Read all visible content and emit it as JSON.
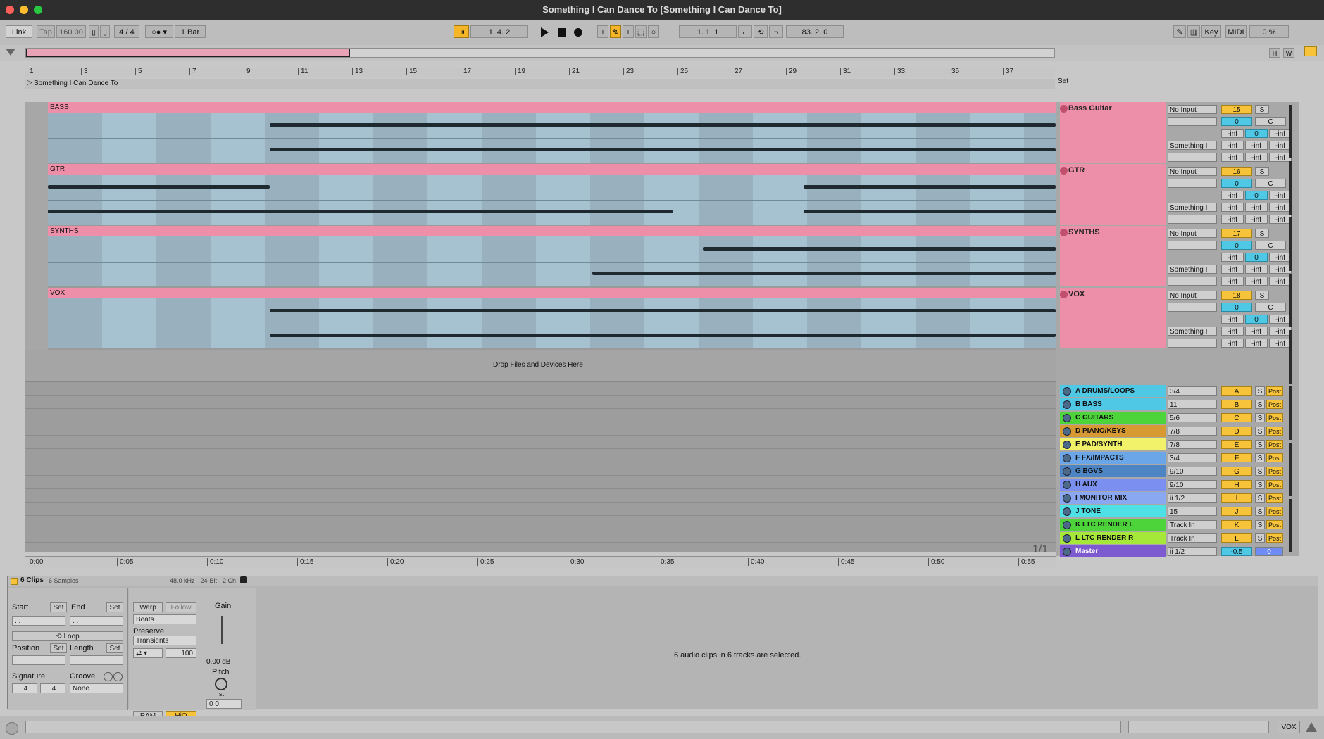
{
  "window": {
    "title": "Something I Can Dance To  [Something I Can Dance To]"
  },
  "control_bar": {
    "link": "Link",
    "tap": "Tap",
    "tempo": "160.00",
    "signature": "4 / 4",
    "quantize": "1 Bar",
    "position": "1.   4.   2",
    "loop_start": "1.   1.   1",
    "loop_length": "83.   2.   0",
    "key": "Key",
    "midi": "MIDI",
    "cpu": "0 %"
  },
  "overview": {
    "h": "H",
    "w": "W"
  },
  "ruler": {
    "bars": [
      "1",
      "3",
      "5",
      "7",
      "9",
      "11",
      "13",
      "15",
      "17",
      "19",
      "21",
      "23",
      "25",
      "27",
      "29",
      "31",
      "33",
      "35",
      "37"
    ]
  },
  "arrangement": {
    "song_name": "Something I Can Dance To",
    "drop_text": "Drop Files and Devices Here",
    "page_indicator": "1/1",
    "tracks": [
      {
        "name": "BASS"
      },
      {
        "name": "GTR"
      },
      {
        "name": "SYNTHS"
      },
      {
        "name": "VOX"
      }
    ]
  },
  "mixer": {
    "set_label": "Set",
    "tracks": [
      {
        "name": "Bass Guitar",
        "input": "No Input",
        "output": "Something I",
        "number": "15",
        "pan": "0",
        "solo": "S",
        "cue": "C",
        "inf": "-inf",
        "zero": "0"
      },
      {
        "name": "GTR",
        "input": "No Input",
        "output": "Something I",
        "number": "16",
        "pan": "0",
        "solo": "S",
        "cue": "C",
        "inf": "-inf",
        "zero": "0"
      },
      {
        "name": "SYNTHS",
        "input": "No Input",
        "output": "Something I",
        "number": "17",
        "pan": "0",
        "solo": "S",
        "cue": "C",
        "inf": "-inf",
        "zero": "0"
      },
      {
        "name": "VOX",
        "input": "No Input",
        "output": "Something I",
        "number": "18",
        "pan": "0",
        "solo": "S",
        "cue": "C",
        "inf": "-inf",
        "zero": "0"
      }
    ],
    "returns": [
      {
        "name": "A DRUMS/LOOPS",
        "route": "3/4",
        "letter": "A",
        "color": "#4fc8e6"
      },
      {
        "name": "B BASS",
        "route": "11",
        "letter": "B",
        "color": "#4fc8e6"
      },
      {
        "name": "C GUITARS",
        "route": "5/6",
        "letter": "C",
        "color": "#4cd43a"
      },
      {
        "name": "D PIANO/KEYS",
        "route": "7/8",
        "letter": "D",
        "color": "#d79a32"
      },
      {
        "name": "E PAD/SYNTH",
        "route": "7/8",
        "letter": "E",
        "color": "#f2f26a"
      },
      {
        "name": "F FX/IMPACTS",
        "route": "3/4",
        "letter": "F",
        "color": "#6aa6e8"
      },
      {
        "name": "G BGVS",
        "route": "9/10",
        "letter": "G",
        "color": "#4c84c4"
      },
      {
        "name": "H AUX",
        "route": "9/10",
        "letter": "H",
        "color": "#7a8ff0"
      },
      {
        "name": "I MONITOR MIX",
        "route": "ii 1/2",
        "letter": "I",
        "color": "#8aa8f2"
      },
      {
        "name": "J TONE",
        "route": "15",
        "letter": "J",
        "color": "#4fe0e6"
      },
      {
        "name": "K LTC RENDER L",
        "route": "Track In",
        "letter": "K",
        "color": "#4cd43a"
      },
      {
        "name": "L LTC RENDER R",
        "route": "Track In",
        "letter": "L",
        "color": "#a6e83a"
      }
    ],
    "master": {
      "name": "Master",
      "route": "ii 1/2",
      "volume": "-0.5",
      "pan": "0"
    },
    "solo": "S",
    "post": "Post"
  },
  "time_ruler": {
    "labels": [
      "0:00",
      "0:05",
      "0:10",
      "0:15",
      "0:20",
      "0:25",
      "0:30",
      "0:35",
      "0:40",
      "0:45",
      "0:50",
      "0:55"
    ]
  },
  "detail": {
    "clips_title": "6 Clips",
    "clips_sub": "6 Samples",
    "format": "48.0 kHz · 24-Bit · 2 Ch",
    "start": "Start",
    "end": "End",
    "set": "Set",
    "loop": "Loop",
    "position": "Position",
    "length": "Length",
    "signature": "Signature",
    "groove": "Groove",
    "sig_num": "4",
    "sig_den": "4",
    "groove_value": "None",
    "warp": "Warp",
    "follow": "Follow",
    "warp_mode": "Beats",
    "preserve": "Preserve",
    "preserve_mode": "Transients",
    "envelope": "100",
    "gain": "Gain",
    "gain_value": "0.00 dB",
    "pitch": "Pitch",
    "st": "st",
    "pitch_semi": "0",
    "pitch_cents": "0",
    "ram": "RAM",
    "hiq": "HiQ",
    "message": "6 audio clips in 6 tracks are selected."
  },
  "status": {
    "track_label": "VOX"
  },
  "colors": {
    "track_pink": "#ee8fa9",
    "clip_blue": "#a6c1cf",
    "accent_yellow": "#f6c33a"
  }
}
